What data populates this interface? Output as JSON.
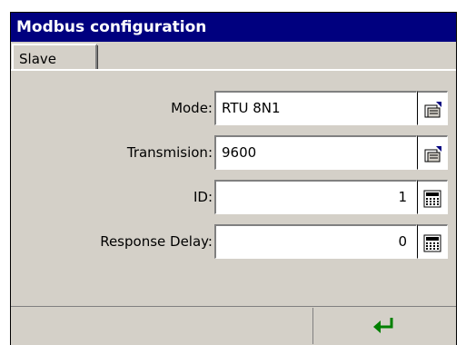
{
  "window": {
    "title": "Modbus configuration"
  },
  "tabs": [
    {
      "label": "Slave"
    }
  ],
  "form": {
    "mode": {
      "label": "Mode:",
      "value": "RTU 8N1"
    },
    "transmision": {
      "label": "Transmision:",
      "value": "9600"
    },
    "id": {
      "label": "ID:",
      "value": "1"
    },
    "response_delay": {
      "label": "Response Delay:",
      "value": "0"
    }
  },
  "icons": {
    "dropdown": "select-list-icon",
    "numeric": "keypad-icon",
    "enter": "enter-arrow-icon"
  },
  "colors": {
    "titlebar": "#00007f",
    "enter_arrow": "#008000",
    "panel": "#d4d0c8"
  }
}
